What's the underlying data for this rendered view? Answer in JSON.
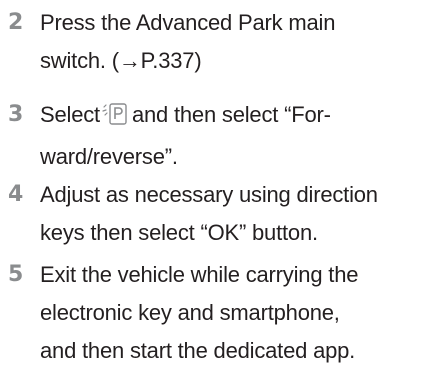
{
  "steps": [
    {
      "number": "2",
      "lines": [
        "Press the Advanced Park main",
        "switch. (→P.337)"
      ]
    },
    {
      "number": "3",
      "line1_before_icon": "Select",
      "icon": "advanced-park-icon",
      "line1_after_icon": "and then select “For-",
      "line2": "ward/reverse”."
    },
    {
      "number": "4",
      "lines": [
        "Adjust as necessary using direction",
        "keys then select “OK” button."
      ]
    },
    {
      "number": "5",
      "lines": [
        "Exit the vehicle while carrying the",
        "electronic key and smartphone,",
        "and then start the dedicated app."
      ]
    }
  ]
}
